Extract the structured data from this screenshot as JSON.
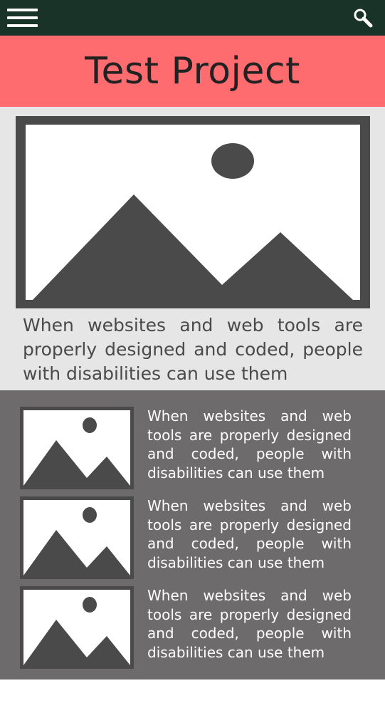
{
  "header": {
    "menu_icon": "hamburger-menu-icon",
    "search_icon": "search-icon",
    "bar_color": "#1a3329"
  },
  "banner": {
    "title": "Test Project",
    "color": "#ff6c6f"
  },
  "hero": {
    "image_icon": "image-placeholder-icon",
    "text": "When websites and web tools are properly designed and coded, people with disabilities can use them"
  },
  "list": {
    "background": "#6d6b6b",
    "items": [
      {
        "image_icon": "image-placeholder-icon",
        "text": "When websites and web tools are properly designed and coded, people with disabilities can use them"
      },
      {
        "image_icon": "image-placeholder-icon",
        "text": "When websites and web tools are properly designed and coded, people with disabilities can use them"
      },
      {
        "image_icon": "image-placeholder-icon",
        "text": "When websites and web tools are properly designed and coded, people with disabilities can use them"
      }
    ]
  }
}
